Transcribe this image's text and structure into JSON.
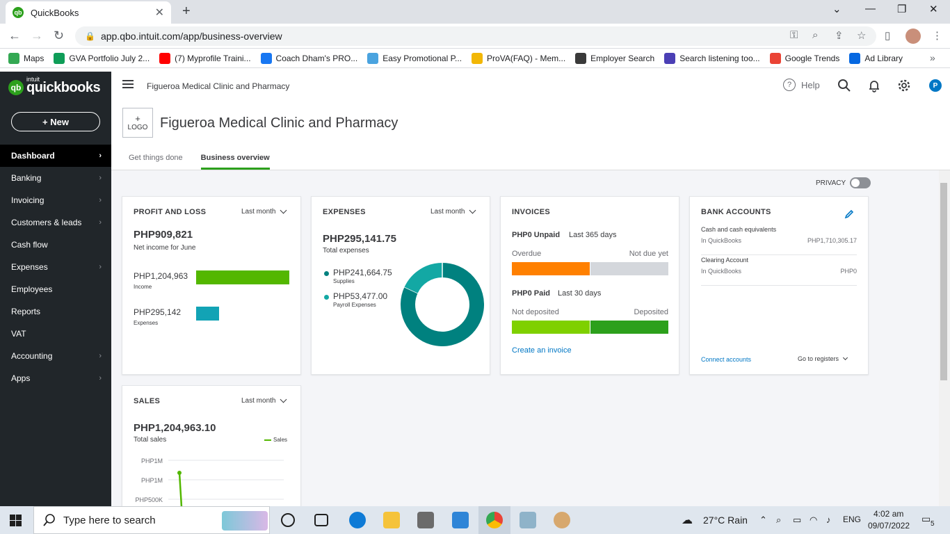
{
  "browser": {
    "tab_title": "QuickBooks",
    "tab_favicon": "qb",
    "url": "app.qbo.intuit.com/app/business-overview",
    "bookmarks": [
      {
        "label": "Maps",
        "color": "#34a853",
        "icon": "maps-icon"
      },
      {
        "label": "GVA Portfolio July 2...",
        "color": "#0f9d58",
        "icon": "sheets-icon"
      },
      {
        "label": "(7) Myprofile Traini...",
        "color": "#ff0000",
        "icon": "youtube-icon"
      },
      {
        "label": "Coach Dham's PRO...",
        "color": "#1877f2",
        "icon": "facebook-icon"
      },
      {
        "label": "Easy Promotional P...",
        "color": "#4aa3df",
        "icon": "page-icon"
      },
      {
        "label": "ProVA(FAQ) - Mem...",
        "color": "#f2b705",
        "icon": "va-icon"
      },
      {
        "label": "Employer Search",
        "color": "#3a3a3a",
        "icon": "globe-icon"
      },
      {
        "label": "Search listening too...",
        "color": "#4b3fb5",
        "icon": "answer-icon"
      },
      {
        "label": "Google Trends",
        "color": "#ea4335",
        "icon": "trends-icon"
      },
      {
        "label": "Ad Library",
        "color": "#0668e1",
        "icon": "meta-icon"
      }
    ],
    "more": "»"
  },
  "qb": {
    "brand_small": "intuit",
    "brand": "quickbooks",
    "new_label": "+   New",
    "nav": [
      {
        "label": "Dashboard",
        "active": true,
        "chev": "›"
      },
      {
        "label": "Banking",
        "chev": "›"
      },
      {
        "label": "Invoicing",
        "chev": "›"
      },
      {
        "label": "Customers & leads",
        "chev": "›"
      },
      {
        "label": "Cash flow",
        "chev": ""
      },
      {
        "label": "Expenses",
        "chev": "›"
      },
      {
        "label": "Employees",
        "chev": ""
      },
      {
        "label": "Reports",
        "chev": ""
      },
      {
        "label": "VAT",
        "chev": ""
      },
      {
        "label": "Accounting",
        "chev": "›"
      },
      {
        "label": "Apps",
        "chev": "›"
      }
    ],
    "company_name": "Figueroa Medical Clinic and Pharmacy",
    "help": "Help",
    "help_mark": "?",
    "user_initial": "P",
    "logo_plus": "+",
    "logo_text": "LOGO",
    "tabs": [
      {
        "label": "Get things done"
      },
      {
        "label": "Business overview",
        "active": true
      }
    ],
    "privacy": "PRIVACY"
  },
  "pnl": {
    "title": "PROFIT AND LOSS",
    "period": "Last month",
    "net": "PHP909,821",
    "net_label": "Net income for June",
    "income": "PHP1,204,963",
    "income_label": "Income",
    "expenses": "PHP295,142",
    "expenses_label": "Expenses",
    "income_ratio": 1.0,
    "expenses_ratio": 0.245,
    "income_color": "#53b700",
    "expenses_color": "#12a3b5"
  },
  "expenses": {
    "title": "EXPENSES",
    "period": "Last month",
    "total": "PHP295,141.75",
    "total_label": "Total expenses",
    "items": [
      {
        "value": "PHP241,664.75",
        "label": "Supplies",
        "color": "#00817f",
        "share": 0.819
      },
      {
        "value": "PHP53,477.00",
        "label": "Payroll Expenses",
        "color": "#13a8a4",
        "share": 0.181
      }
    ]
  },
  "invoices": {
    "title": "INVOICES",
    "unpaid": "PHP0 Unpaid",
    "unpaid_period": "Last 365 days",
    "overdue": "Overdue",
    "not_due": "Not due yet",
    "paid": "PHP0 Paid",
    "paid_period": "Last 30 days",
    "not_deposited": "Not deposited",
    "deposited": "Deposited",
    "create": "Create an invoice",
    "colors": {
      "overdue": "#ff8000",
      "not_due": "#d4d7dc",
      "not_deposited": "#7fd000",
      "deposited": "#2ca01c"
    }
  },
  "bank": {
    "title": "BANK ACCOUNTS",
    "accounts": [
      {
        "name": "Cash and cash equivalents",
        "source": "In QuickBooks",
        "balance": "PHP1,710,305.17"
      },
      {
        "name": "Clearing Account",
        "source": "In QuickBooks",
        "balance": "PHP0"
      }
    ],
    "connect": "Connect accounts",
    "registers": "Go to registers"
  },
  "sales": {
    "title": "SALES",
    "period": "Last month",
    "total": "PHP1,204,963.10",
    "total_label": "Total sales",
    "legend": "Sales",
    "ticks": [
      "PHP1M",
      "PHP1M",
      "PHP500K"
    ],
    "color": "#53b700"
  },
  "chart_data": [
    {
      "type": "bar",
      "categories": [
        "Income",
        "Expenses"
      ],
      "values": [
        1204963,
        295142
      ]
    },
    {
      "type": "pie",
      "categories": [
        "Supplies",
        "Payroll Expenses"
      ],
      "values": [
        241664.75,
        53477.0
      ]
    },
    {
      "type": "line",
      "series": [
        {
          "name": "Sales",
          "values": [
            1204963.1
          ]
        }
      ]
    }
  ],
  "taskbar": {
    "search": "Type here to search",
    "weather": "27°C  Rain",
    "lang": "ENG",
    "time": "4:02 am",
    "date": "09/07/2022",
    "notif": "5"
  }
}
